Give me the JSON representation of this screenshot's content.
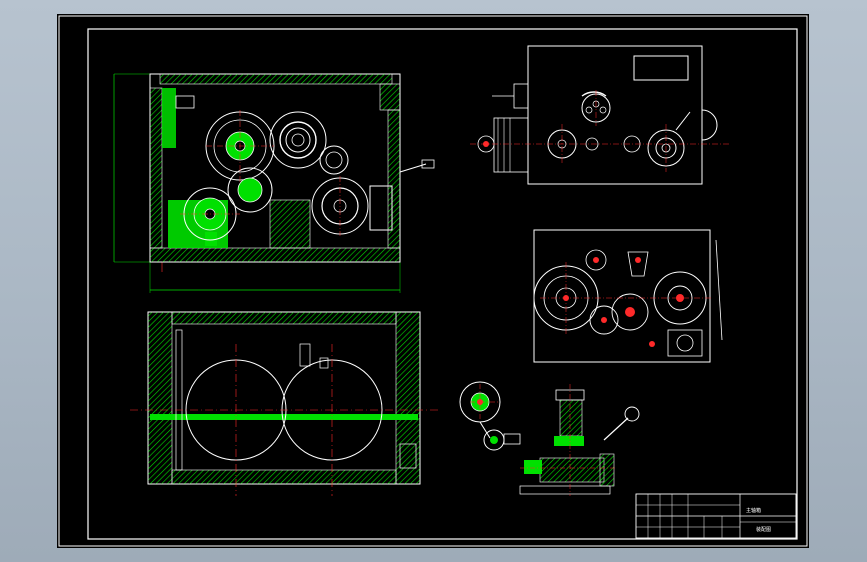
{
  "drawing": {
    "sheet_background": "#000000",
    "viewport_background": "#aab7c4",
    "colors": {
      "outline": "#ffffff",
      "hatch": "#00e000",
      "centerline": "#ff2a2a",
      "dimension": "#00e000",
      "frame": "#ffffff"
    },
    "views": [
      "front-section-view",
      "side-exterior-view",
      "rear-exterior-view",
      "top-section-view",
      "shift-mechanism-detail"
    ]
  },
  "title_block": {
    "drawing_name": "装配图",
    "part_name": "主轴箱",
    "cells": [
      "",
      "",
      "",
      "",
      "",
      "",
      "",
      ""
    ]
  }
}
